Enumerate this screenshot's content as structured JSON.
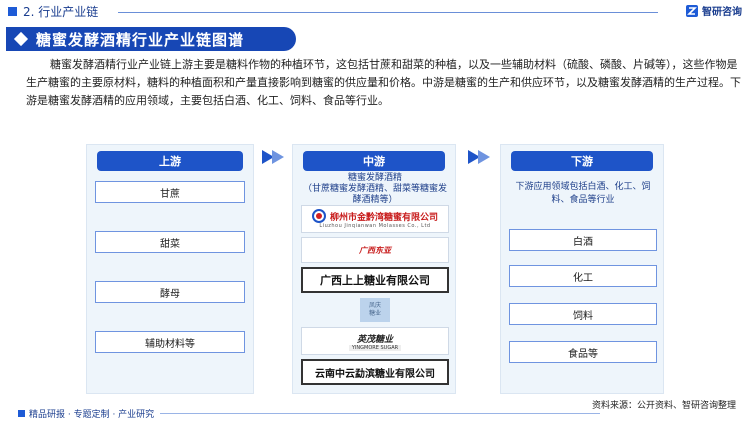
{
  "header": {
    "section_title": "2. 行业产业链",
    "logo_text": "智研咨询"
  },
  "banner": {
    "title": "糖蜜发酵酒精行业产业链图谱"
  },
  "intro": {
    "text": "糖蜜发酵酒精行业产业链上游主要是糖料作物的种植环节，这包括甘蔗和甜菜的种植，以及一些辅助材料（硫酸、磷酸、片碱等），这些作物是生产糖蜜的主要原材料，糖料的种植面积和产量直接影响到糖蜜的供应量和价格。中游是糖蜜的生产和供应环节，以及糖蜜发酵酒精的生产过程。下游是糖蜜发酵酒精的应用领域，主要包括白酒、化工、饲料、食品等行业。"
  },
  "upstream": {
    "title": "上游",
    "items": [
      "甘蔗",
      "甜菜",
      "酵母",
      "辅助材料等"
    ]
  },
  "midstream": {
    "title": "中游",
    "description": "糖蜜发酵酒精\n（甘蔗糖蜜发酵酒精、甜菜等糖蜜发酵酒精等）",
    "companies": {
      "jqw_cn": "柳州市金黔湾糖蜜有限公司",
      "jqw_en": "Liuzhou Jinqianwan Molasses Co., Ltd",
      "gxdl": "广西东亚",
      "gxss": "广西上上糖业有限公司",
      "fq_line1": "凤庆",
      "fq_line2": "糖业",
      "yn_cn": "英茂糖业",
      "yn_en": "YINGMORE SUGAR",
      "ynzy": "云南中云勐滨糖业有限公司"
    }
  },
  "downstream": {
    "title": "下游",
    "description": "下游应用领域包括白酒、化工、饲料、食品等行业",
    "items": [
      "白酒",
      "化工",
      "饲料",
      "食品等"
    ]
  },
  "footer": {
    "source": "资料来源：公开资料、智研咨询整理",
    "slogan": "精品研报 · 专题定制 · 产业研究"
  },
  "colors": {
    "primary": "#1e54c8",
    "banner": "#1747b5",
    "panel_bg": "#eef5fb"
  }
}
